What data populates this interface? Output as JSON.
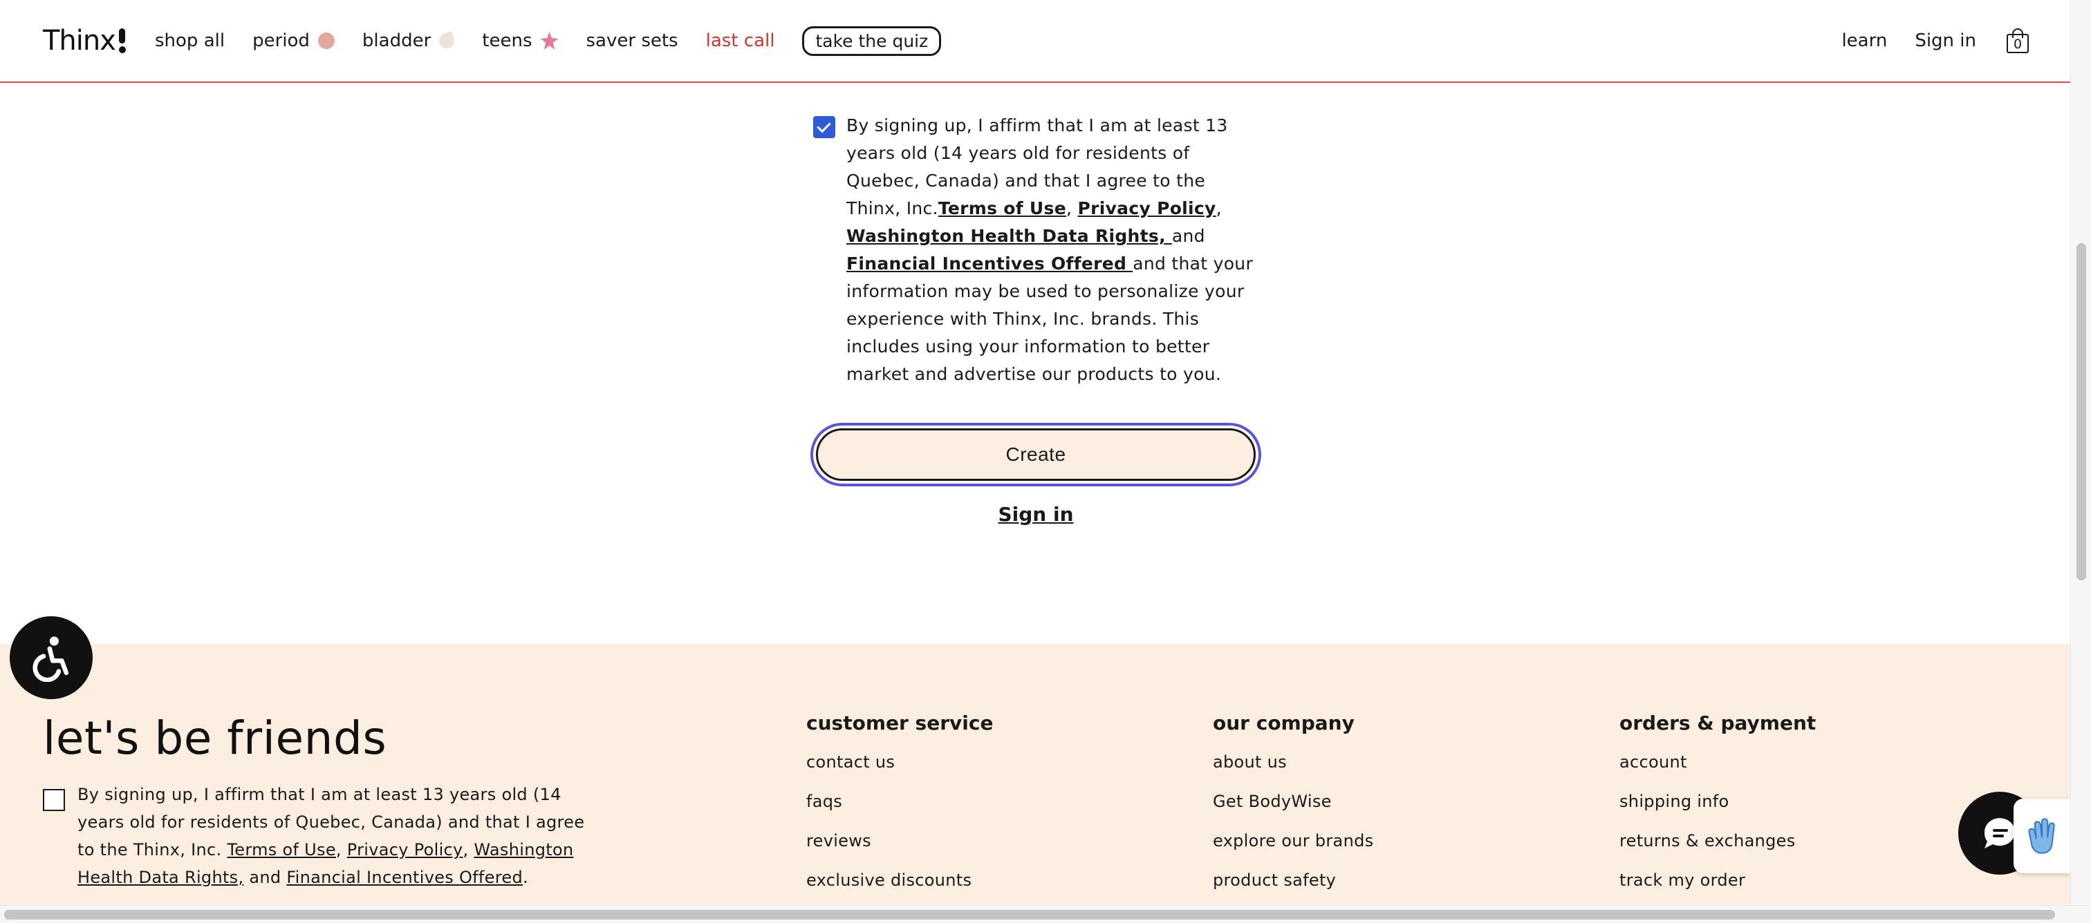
{
  "header": {
    "logo": "Thinx",
    "nav": [
      {
        "label": "shop all"
      },
      {
        "label": "period"
      },
      {
        "label": "bladder"
      },
      {
        "label": "teens"
      },
      {
        "label": "saver sets"
      },
      {
        "label": "last call"
      }
    ],
    "quiz_label": "take the quiz",
    "learn_label": "learn",
    "signin_label": "Sign in",
    "cart_count": "0"
  },
  "consent": {
    "checked": true,
    "text_before": "By signing up, I affirm that I am at least 13 years old (14 years old for residents of Quebec, Canada) and that I agree to the Thinx, Inc.",
    "terms": "Terms of Use",
    "comma1": ", ",
    "privacy": "Privacy Policy",
    "comma2": ", ",
    "washington": "Washington Health Data Rights, ",
    "and1": "and ",
    "incentives": "Financial Incentives Offered ",
    "text_after": "and that your information may be used to personalize your experience with Thinx, Inc. brands. This includes using your information to better market and advertise our products to you."
  },
  "create_label": "Create",
  "signin_link": "Sign in",
  "footer": {
    "title": "let's be friends",
    "consent_before": "By signing up, I affirm that I am at least 13 years old (14 years old for residents of Quebec, Canada) and that I agree to the Thinx, Inc. ",
    "terms": "Terms of Use",
    "comma1": ", ",
    "privacy": "Privacy Policy",
    "comma2": ", ",
    "washington": "Washington Health Data Rights,",
    "and1": " and ",
    "incentives": "Financial Incentives Offered",
    "period": ".",
    "columns": [
      {
        "title": "customer service",
        "items": [
          "contact us",
          "faqs",
          "reviews",
          "exclusive discounts"
        ]
      },
      {
        "title": "our company",
        "items": [
          "about us",
          "Get BodyWise",
          "explore our brands",
          "product safety"
        ]
      },
      {
        "title": "orders & payment",
        "items": [
          "account",
          "shipping info",
          "returns & exchanges",
          "track my order"
        ]
      }
    ]
  },
  "colors": {
    "accent_red": "#d6332d",
    "checkbox_blue": "#2f5bd6",
    "focus_ring": "#5a55d6",
    "footer_bg": "#fcefe1"
  }
}
